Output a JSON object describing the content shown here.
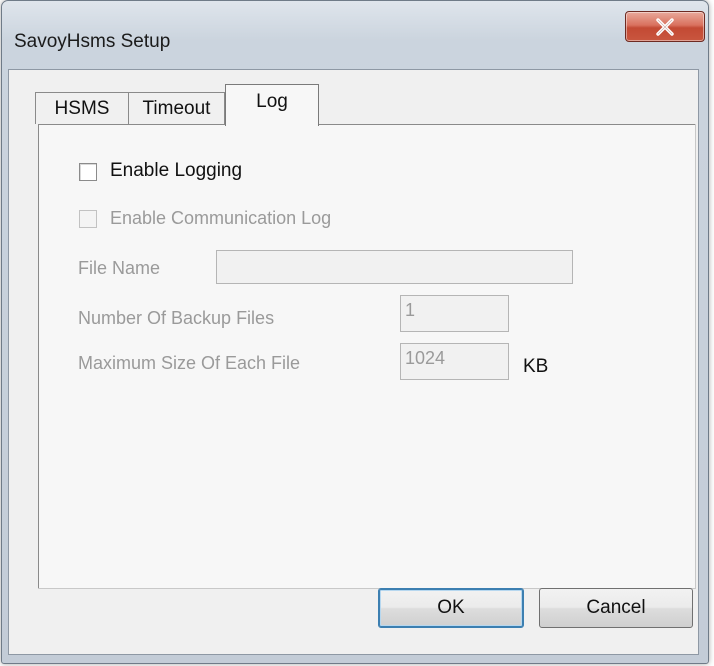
{
  "window": {
    "title": "SavoyHsms Setup",
    "close_icon": "close-icon"
  },
  "tabs": [
    {
      "label": "HSMS",
      "selected": false
    },
    {
      "label": "Timeout",
      "selected": false
    },
    {
      "label": "Log",
      "selected": true
    }
  ],
  "log": {
    "enable_logging": {
      "label": "Enable Logging",
      "checked": false,
      "enabled": true
    },
    "enable_comm_log": {
      "label": "Enable Communication Log",
      "checked": false,
      "enabled": false
    },
    "file_name": {
      "label": "File Name",
      "value": "",
      "enabled": false
    },
    "backup_files": {
      "label": "Number Of Backup Files",
      "value": "1",
      "enabled": false
    },
    "max_size": {
      "label": "Maximum Size Of Each File",
      "value": "1024",
      "unit": "KB",
      "enabled": false
    }
  },
  "buttons": {
    "ok": "OK",
    "cancel": "Cancel"
  }
}
